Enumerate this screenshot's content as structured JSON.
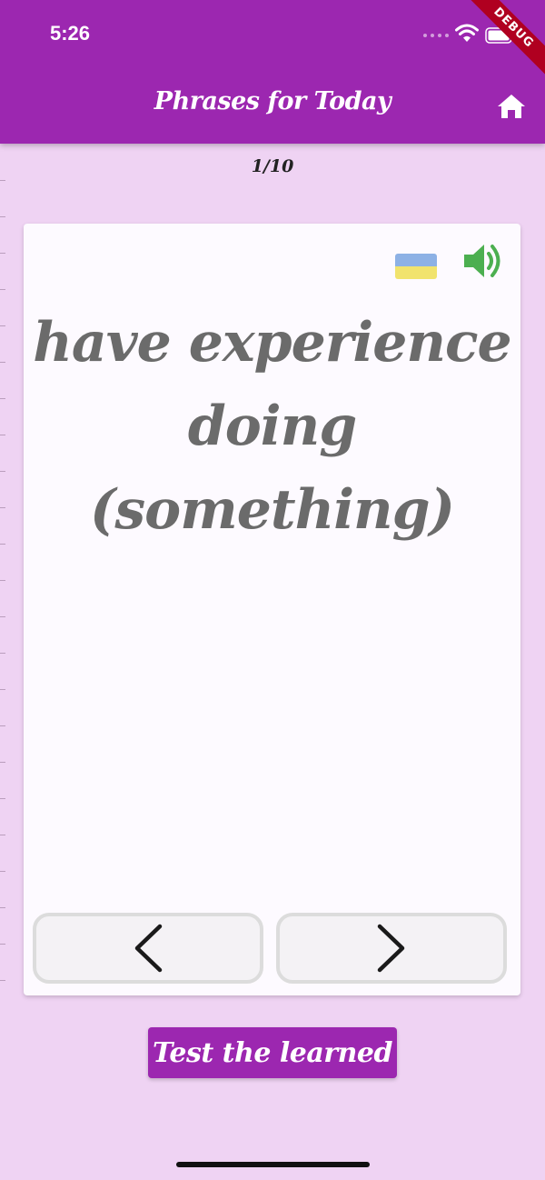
{
  "status_bar": {
    "time": "5:26"
  },
  "debug_banner": "DEBUG",
  "app_bar": {
    "title": "Phrases for Today",
    "home_icon": "home-icon"
  },
  "counter": "1/10",
  "card": {
    "flag_icon": "ukraine-flag-icon",
    "speaker_icon": "speaker-icon",
    "phrase_line1": "have experience",
    "phrase_line2": "doing (something)",
    "prev_icon": "chevron-left-icon",
    "next_icon": "chevron-right-icon"
  },
  "test_button": {
    "label": "Test the learned"
  },
  "colors": {
    "primary": "#9c27b0",
    "background": "#efd3f3",
    "speaker": "#4caf50",
    "flag_blue": "#8db1e5",
    "flag_yellow": "#f1e36d"
  }
}
